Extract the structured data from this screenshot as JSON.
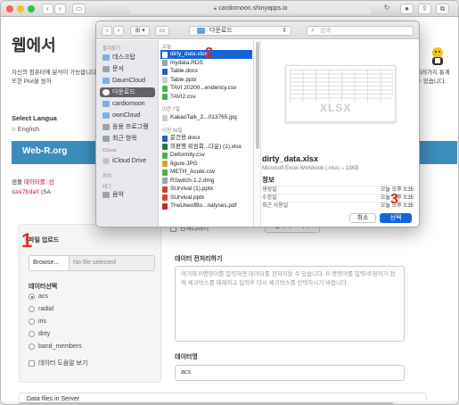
{
  "browser": {
    "url": "cardiomoon.shinyapps.io",
    "back_icon": "chevron-left",
    "forward_icon": "chevron-right"
  },
  "page": {
    "title": "웹에서",
    "intro_left": "자신의 컴퓨터에 분석이 가능합니다 또한 Plot을 원하",
    "intro_right": "계러가지 통계 수 있습니다.",
    "language_label": "Select Langua",
    "language_option": "English",
    "banner_text": "Web-R.org",
    "code_note_prefix": "샘플",
    "code_note_code1": "데이터를 선",
    "code_note_code2": "sas7bdat",
    "code_note_suffix": "(SA"
  },
  "upload_panel": {
    "label": "파일 업로드",
    "browse_label": "Browse...",
    "file_placeholder": "No file selected",
    "data_select_label": "데이터선택",
    "datasets": [
      "acs",
      "radial",
      "iris",
      "dirty",
      "band_members"
    ],
    "selected_dataset": "acs",
    "view_data_label": "데이터 도움말 보기"
  },
  "preprocess": {
    "checkbox_label": "전처리하기",
    "reset_label": "전처리 초기화",
    "textarea_label": "데이터 전처리하기",
    "textarea_placeholder": "여기에 R명령어를 입력하면 데이터를 전처리할 수 있습니다. R 명령어를 입력/수정하기 전에 체크박스를 해제하고 입력후 다시 체크박스를 선택하시기 바랍니다.",
    "dataname_label": "데이터명",
    "dataname_value": "acs"
  },
  "bottom": {
    "label": "Data files in Server"
  },
  "dialog": {
    "view_mode": "⊞ ▾",
    "folder": "다운로드",
    "search_placeholder": "검색",
    "sidebar": {
      "favorites_label": "즐겨찾기",
      "favorites": [
        "데스크탑",
        "문서",
        "DaumCloud",
        "다운로드",
        "cardiomoon",
        "ownCloud",
        "응용 프로그램",
        "최근 항목"
      ],
      "selected_favorite": "다운로드",
      "icloud_label": "iCloud",
      "icloud_items": [
        "iCloud Drive"
      ],
      "locations_label": "위치",
      "tags_label": "태그",
      "tags": [
        "음악"
      ]
    },
    "files": {
      "today_label": "오늘",
      "today": [
        "dirty_data.xlsx",
        "mydata.RDS",
        "Table.docx",
        "Table.pptx",
        "TAVI 20200...endency.csv",
        "TAVI2.csv"
      ],
      "selected_file": "dirty_data.xlsx",
      "last7_label": "이전 7일",
      "last7": [
        "KakaoTalk_2...013765.jpg"
      ],
      "last30_label": "이전 30일",
      "last30": [
        "문건용.docx",
        "의편행 위원회...다운) (1).xlsx",
        "Deformity.csv",
        "figure.JPG",
        "METH_Acute.csv",
        "RSwitch-1.2.dmg",
        "SUrvival (1).pptx",
        "SUrvival.pptx",
        "TheUseofBo...nalyses.pdf"
      ]
    },
    "preview": {
      "thumb_text": "XLSX",
      "name": "dirty_data.xlsx",
      "kind": "Microsoft Excel Workbook (.xlsx) – 13KB",
      "info_label": "정보",
      "rows": [
        {
          "k": "생성일",
          "v": "오늘 오후 3:35"
        },
        {
          "k": "수정일",
          "v": "오늘 오후 3:35"
        },
        {
          "k": "최근 사용일",
          "v": "오늘 오후 3:35"
        }
      ]
    },
    "cancel_label": "취소",
    "open_label": "선택"
  },
  "markers": [
    "1",
    "2",
    "3"
  ],
  "colors": {
    "accent": "#1565d8",
    "banner": "#3c8dbc",
    "marker": "#e8291c"
  }
}
